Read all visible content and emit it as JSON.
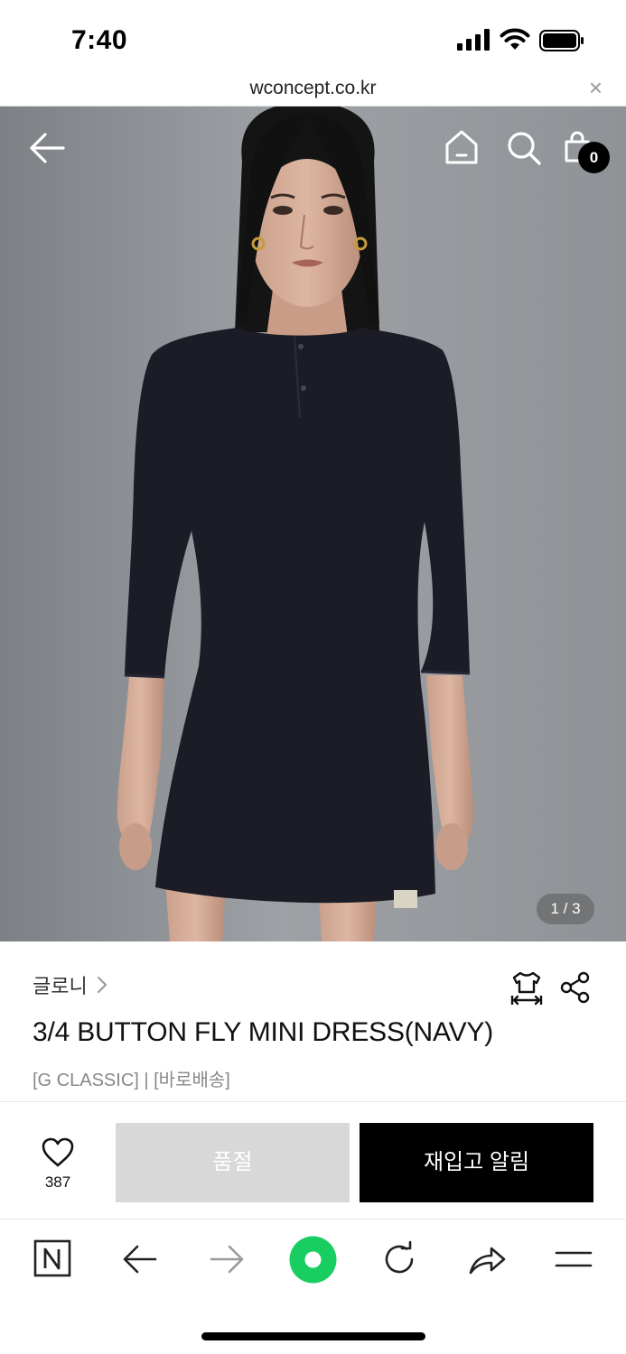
{
  "status_bar": {
    "time": "7:40",
    "icons": [
      "cellular-signal-icon",
      "wifi-icon",
      "battery-icon"
    ]
  },
  "url_bar": {
    "url": "wconcept.co.kr",
    "close_label": "×"
  },
  "hero": {
    "cart_count": "0",
    "page_indicator": "1 / 3",
    "icons": [
      "back-arrow-icon",
      "home-icon",
      "search-icon",
      "shopping-bag-icon"
    ]
  },
  "product": {
    "brand": "글로니",
    "title": "3/4 BUTTON FLY MINI DRESS(NAVY)",
    "tags": "[G CLASSIC] | [바로배송]",
    "icons": [
      "size-guide-icon",
      "share-icon"
    ]
  },
  "actions": {
    "like_count": "387",
    "soldout_label": "품절",
    "restock_label": "재입고 알림"
  },
  "browser_toolbar": {
    "items": [
      "naver-n-icon",
      "back-icon",
      "forward-icon",
      "green-circle-icon",
      "reload-icon",
      "share-icon",
      "menu-icon"
    ]
  },
  "colors": {
    "primary_button": "#000000",
    "disabled_button": "#d8d8d8",
    "accent_green": "#19ce60",
    "photo_background": "#9a9da1",
    "dress": "#1b1c25"
  }
}
